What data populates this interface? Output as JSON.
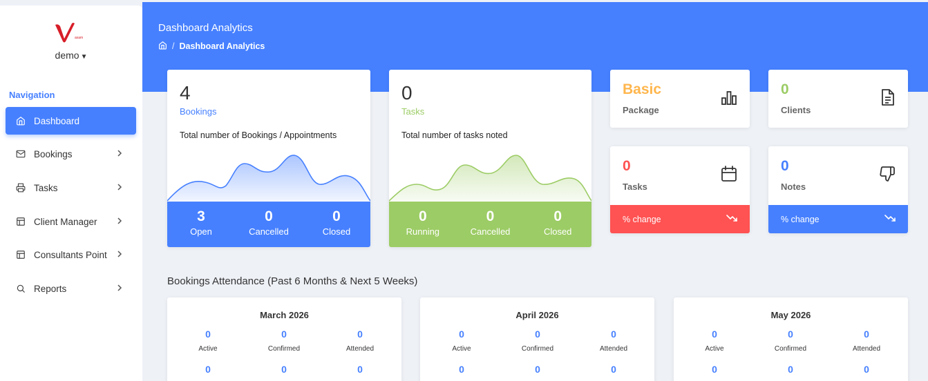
{
  "header": {
    "title": "Dashboard Analytics",
    "breadcrumb_current": "Dashboard Analytics",
    "breadcrumb_sep": "/"
  },
  "sidebar": {
    "user": "demo",
    "nav_heading": "Navigation",
    "items": [
      {
        "label": "Dashboard",
        "icon": "home-icon",
        "active": true
      },
      {
        "label": "Bookings",
        "icon": "mail-icon"
      },
      {
        "label": "Tasks",
        "icon": "printer-icon"
      },
      {
        "label": "Client Manager",
        "icon": "layout-icon"
      },
      {
        "label": "Consultants Point",
        "icon": "layout-icon"
      },
      {
        "label": "Reports",
        "icon": "search-icon"
      }
    ]
  },
  "bookings_card": {
    "count": "4",
    "label": "Bookings",
    "description": "Total number of Bookings / Appointments",
    "stats": [
      {
        "value": "3",
        "label": "Open"
      },
      {
        "value": "0",
        "label": "Cancelled"
      },
      {
        "value": "0",
        "label": "Closed"
      }
    ]
  },
  "tasks_card": {
    "count": "0",
    "label": "Tasks",
    "description": "Total number of tasks noted",
    "stats": [
      {
        "value": "0",
        "label": "Running"
      },
      {
        "value": "0",
        "label": "Cancelled"
      },
      {
        "value": "0",
        "label": "Closed"
      }
    ]
  },
  "package_card": {
    "value": "Basic",
    "label": "Package",
    "icon": "bar-chart-icon"
  },
  "clients_card": {
    "value": "0",
    "label": "Clients",
    "icon": "file-text-icon"
  },
  "tasks_mini_card": {
    "value": "0",
    "label": "Tasks",
    "icon": "calendar-icon",
    "change_label": "% change"
  },
  "notes_card": {
    "value": "0",
    "label": "Notes",
    "icon": "thumbs-down-icon",
    "change_label": "% change"
  },
  "attendance": {
    "title": "Bookings Attendance (Past 6 Months & Next 5 Weeks)",
    "months": [
      {
        "name": "March 2026",
        "row1": [
          {
            "value": "0",
            "label": "Active"
          },
          {
            "value": "0",
            "label": "Confirmed"
          },
          {
            "value": "0",
            "label": "Attended"
          }
        ],
        "row2": [
          "0",
          "0",
          "0"
        ]
      },
      {
        "name": "April 2026",
        "row1": [
          {
            "value": "0",
            "label": "Active"
          },
          {
            "value": "0",
            "label": "Confirmed"
          },
          {
            "value": "0",
            "label": "Attended"
          }
        ],
        "row2": [
          "0",
          "0",
          "0"
        ]
      },
      {
        "name": "May 2026",
        "row1": [
          {
            "value": "0",
            "label": "Active"
          },
          {
            "value": "0",
            "label": "Confirmed"
          },
          {
            "value": "0",
            "label": "Attended"
          }
        ],
        "row2": [
          "0",
          "0",
          "0"
        ]
      }
    ]
  },
  "colors": {
    "primary": "#4680ff",
    "success": "#9ccc65",
    "warning": "#ffb64d",
    "danger": "#ff5252",
    "background": "#eef1f6"
  }
}
